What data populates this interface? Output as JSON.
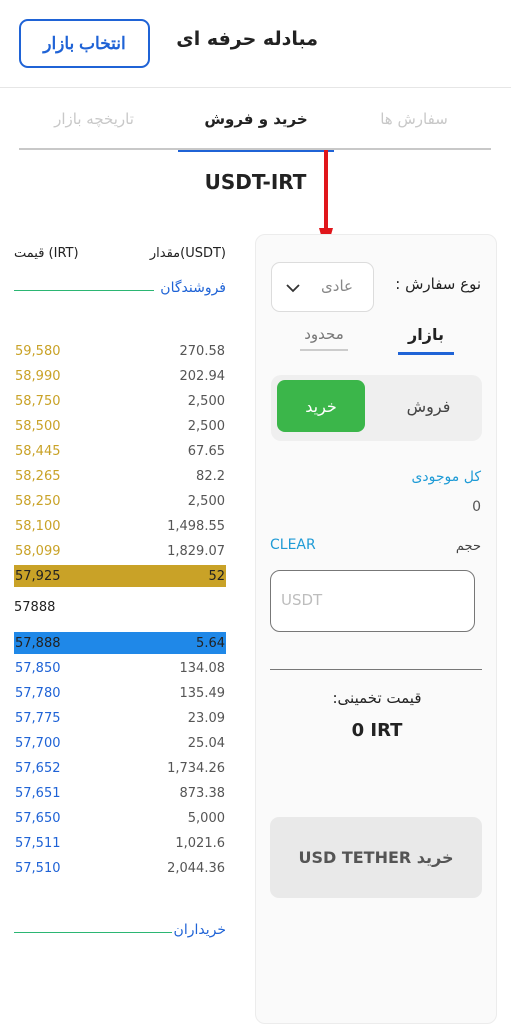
{
  "header": {
    "title": "مبادله حرفه ای",
    "market_button": "انتخاب بازار"
  },
  "tabs": {
    "orders": "سفارش ها",
    "trade": "خرید و فروش",
    "history": "تاریخچه بازار"
  },
  "pair": "USDT-IRT",
  "order_book": {
    "price_header": "قیمت (IRT)",
    "amount_header": "مقدار(USDT)",
    "sellers_label": "فروشندگان",
    "buyers_label": "خریداران",
    "asks": [
      {
        "price": "59,580",
        "amount": "270.58"
      },
      {
        "price": "58,990",
        "amount": "202.94"
      },
      {
        "price": "58,750",
        "amount": "2,500"
      },
      {
        "price": "58,500",
        "amount": "2,500"
      },
      {
        "price": "58,445",
        "amount": "67.65"
      },
      {
        "price": "58,265",
        "amount": "82.2"
      },
      {
        "price": "58,250",
        "amount": "2,500"
      },
      {
        "price": "58,100",
        "amount": "1,498.55"
      },
      {
        "price": "58,099",
        "amount": "1,829.07"
      },
      {
        "price": "57,925",
        "amount": "52"
      }
    ],
    "mid_price": "57888",
    "bids": [
      {
        "price": "57,888",
        "amount": "5.64"
      },
      {
        "price": "57,850",
        "amount": "134.08"
      },
      {
        "price": "57,780",
        "amount": "135.49"
      },
      {
        "price": "57,775",
        "amount": "23.09"
      },
      {
        "price": "57,700",
        "amount": "25.04"
      },
      {
        "price": "57,652",
        "amount": "1,734.26"
      },
      {
        "price": "57,651",
        "amount": "873.38"
      },
      {
        "price": "57,650",
        "amount": "5,000"
      },
      {
        "price": "57,511",
        "amount": "1,021.6"
      },
      {
        "price": "57,510",
        "amount": "2,044.36"
      }
    ]
  },
  "panel": {
    "order_type_label": "نوع سفارش :",
    "order_type_value": "عادی",
    "mode_market": "بازار",
    "mode_limit": "محدود",
    "sell": "فروش",
    "buy": "خرید",
    "balance_label": "کل موجودی",
    "balance_value": "0",
    "volume_label": "حجم",
    "clear": "CLEAR",
    "volume_placeholder": "USDT",
    "estimate_label": "قیمت تخمینی:",
    "estimate_value": "0 IRT",
    "submit": "خرید USD TETHER"
  },
  "icons": {
    "chevron": "chevron-down-icon",
    "arrow": "arrow-down-annotation"
  },
  "colors": {
    "primary": "#1f63d6",
    "buy_green": "#3bb64a",
    "ask_gold": "#c9a227",
    "bid_blue": "#1f88e8",
    "annotation_red": "#e0161b"
  }
}
